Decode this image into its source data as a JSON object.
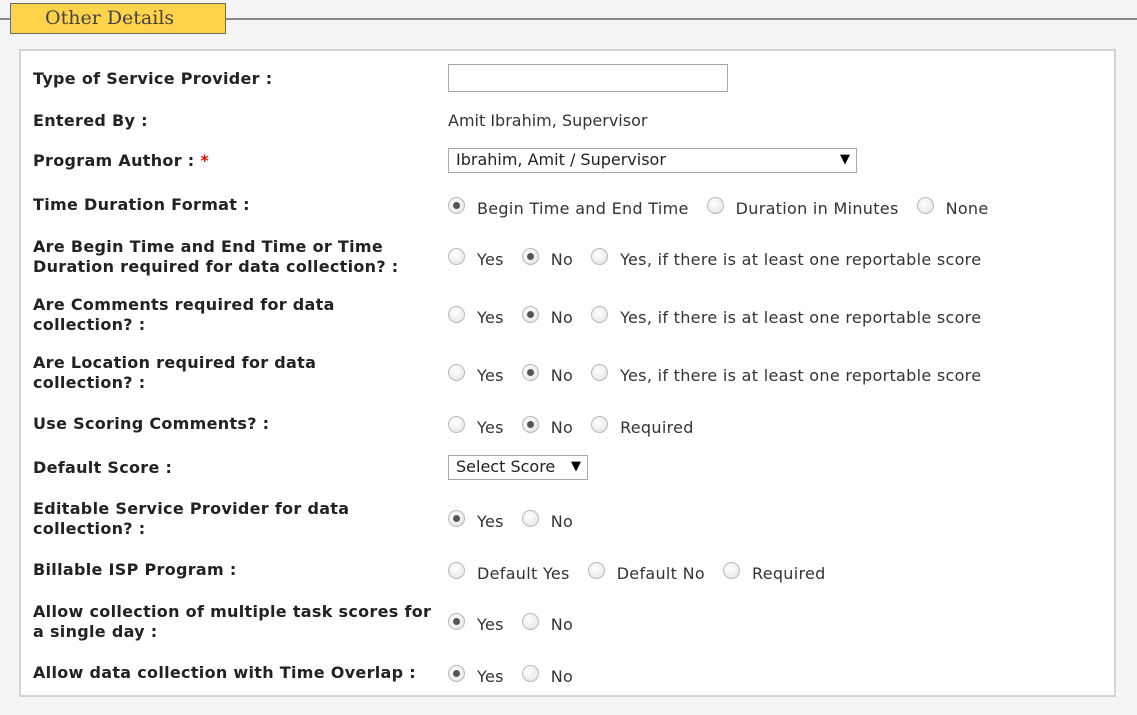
{
  "section": {
    "title": "Other Details"
  },
  "fields": {
    "service_provider": {
      "label": "Type of Service Provider :",
      "value": "",
      "placeholder": ""
    },
    "entered_by": {
      "label": "Entered By :",
      "value": "Amit Ibrahim, Supervisor"
    },
    "program_author": {
      "label": "Program Author :",
      "required_mark": "*",
      "selected": "Ibrahim, Amit / Supervisor"
    },
    "time_duration_format": {
      "label": "Time Duration Format :",
      "options": [
        "Begin Time and End Time",
        "Duration in Minutes",
        "None"
      ],
      "selected": "Begin Time and End Time"
    },
    "begin_end_required": {
      "label_line1": "Are Begin Time and End Time or Time",
      "label_line2": "Duration required for data collection? :",
      "options": [
        "Yes",
        "No",
        "Yes, if there is at least one reportable score"
      ],
      "selected": "No"
    },
    "comments_required": {
      "label_line1": "Are Comments required for data",
      "label_line2": "collection? :",
      "options": [
        "Yes",
        "No",
        "Yes, if there is at least one reportable score"
      ],
      "selected": "No"
    },
    "location_required": {
      "label_line1": "Are Location required for data",
      "label_line2": "collection? :",
      "options": [
        "Yes",
        "No",
        "Yes, if there is at least one reportable score"
      ],
      "selected": "No"
    },
    "scoring_comments": {
      "label": "Use Scoring Comments? :",
      "options": [
        "Yes",
        "No",
        "Required"
      ],
      "selected": "No"
    },
    "default_score": {
      "label": "Default Score :",
      "selected": "Select Score"
    },
    "editable_provider": {
      "label_line1": "Editable Service Provider for data",
      "label_line2": "collection? :",
      "options": [
        "Yes",
        "No"
      ],
      "selected": "Yes"
    },
    "billable_isp": {
      "label": "Billable ISP Program :",
      "options": [
        "Default Yes",
        "Default No",
        "Required"
      ],
      "selected": ""
    },
    "multiple_task_scores": {
      "label_line1": "Allow collection of multiple task scores for",
      "label_line2": "a single day :",
      "options": [
        "Yes",
        "No"
      ],
      "selected": "Yes"
    },
    "time_overlap": {
      "label": "Allow data collection with Time Overlap :",
      "options": [
        "Yes",
        "No"
      ],
      "selected": "Yes"
    }
  },
  "icons": {
    "dropdown": "triangle-down-icon"
  }
}
